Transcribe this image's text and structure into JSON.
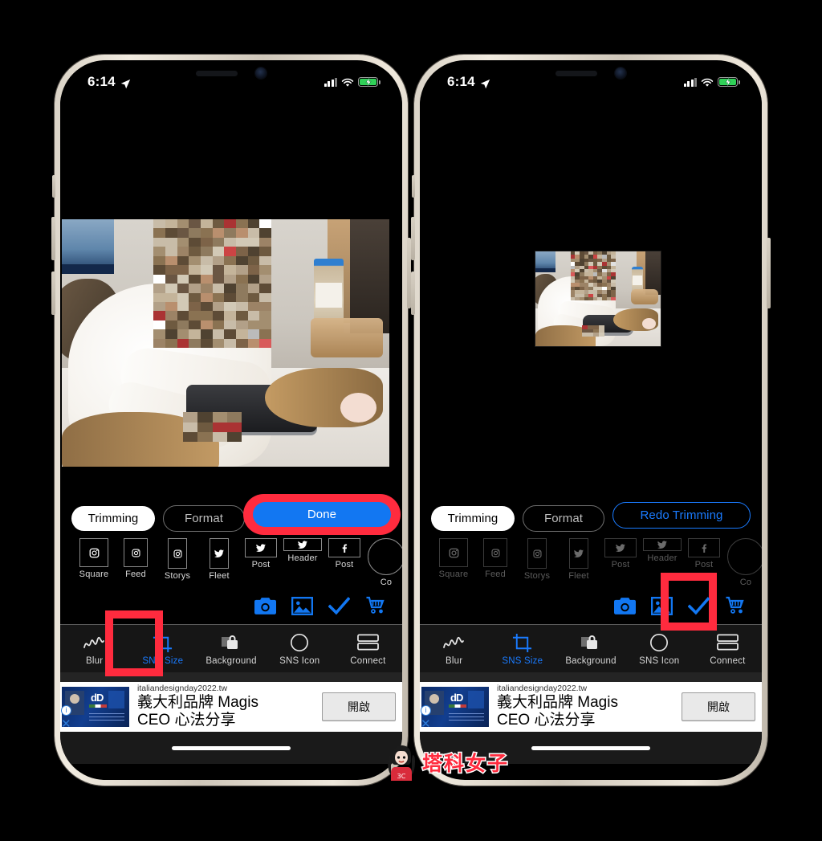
{
  "meta": {
    "accent_blue": "#1277f2",
    "highlight_red": "#ff2b3e",
    "link_blue": "#1a7bff",
    "battery_green": "#30d158"
  },
  "watermark": {
    "text": "塔科女子",
    "badge": "3C"
  },
  "phones": [
    {
      "id": "left",
      "status_bar": {
        "time": "6:14",
        "location_icon": "location-arrow-icon",
        "cellular_icon": "cellular-bars-icon",
        "wifi_icon": "wifi-icon",
        "battery_icon": "battery-charging-icon"
      },
      "editor": {
        "tabs": {
          "trimming": "Trimming",
          "format": "Format"
        },
        "primary_action": "Done",
        "primary_action_highlighted": true,
        "formats": [
          {
            "label": "Square",
            "icon": "instagram-icon",
            "shape": "sq"
          },
          {
            "label": "Feed",
            "icon": "instagram-icon",
            "shape": "fd"
          },
          {
            "label": "Storys",
            "icon": "instagram-icon",
            "shape": "st"
          },
          {
            "label": "Fleet",
            "icon": "twitter-icon",
            "shape": "fl"
          },
          {
            "label": "Post",
            "icon": "twitter-icon",
            "shape": "tw1"
          },
          {
            "label": "Header",
            "icon": "twitter-icon",
            "shape": "tw2"
          },
          {
            "label": "Post",
            "icon": "facebook-icon",
            "shape": "fb1"
          },
          {
            "label": "Co",
            "icon": "circle-icon",
            "shape": "cc"
          }
        ],
        "formats_dimmed": false,
        "action_icons": [
          {
            "name": "camera-icon"
          },
          {
            "name": "photo-library-icon"
          },
          {
            "name": "checkmark-icon"
          },
          {
            "name": "cart-icon"
          }
        ],
        "checkmark_highlighted": false
      },
      "tabbar": {
        "active": "SNS Size",
        "highlighted_tab": "SNS Size",
        "items": [
          {
            "label": "Blur",
            "icon": "scribble-icon"
          },
          {
            "label": "SNS Size",
            "icon": "crop-icon"
          },
          {
            "label": "Background",
            "icon": "lock-icon"
          },
          {
            "label": "SNS Icon",
            "icon": "circle-outline-icon"
          },
          {
            "label": "Connect",
            "icon": "stacked-rows-icon"
          }
        ]
      },
      "ad": {
        "url": "italiandesignday2022.tw",
        "headline_line1": "義大利品牌 Magis",
        "headline_line2": "CEO 心法分享",
        "cta": "開啟",
        "info_icon": "info-icon",
        "close_icon": "close-icon"
      },
      "photo": {
        "size": "large",
        "description": "cat lying on desk with mosaic-censored face"
      }
    },
    {
      "id": "right",
      "status_bar": {
        "time": "6:14",
        "location_icon": "location-arrow-icon",
        "cellular_icon": "cellular-bars-icon",
        "wifi_icon": "wifi-icon",
        "battery_icon": "battery-charging-icon"
      },
      "editor": {
        "tabs": {
          "trimming": "Trimming",
          "format": "Format"
        },
        "primary_action": "Redo Trimming",
        "primary_action_highlighted": false,
        "formats": [
          {
            "label": "Square",
            "icon": "instagram-icon",
            "shape": "sq"
          },
          {
            "label": "Feed",
            "icon": "instagram-icon",
            "shape": "fd"
          },
          {
            "label": "Storys",
            "icon": "instagram-icon",
            "shape": "st"
          },
          {
            "label": "Fleet",
            "icon": "twitter-icon",
            "shape": "fl"
          },
          {
            "label": "Post",
            "icon": "twitter-icon",
            "shape": "tw1"
          },
          {
            "label": "Header",
            "icon": "twitter-icon",
            "shape": "tw2"
          },
          {
            "label": "Post",
            "icon": "facebook-icon",
            "shape": "fb1"
          },
          {
            "label": "Co",
            "icon": "circle-icon",
            "shape": "cc"
          }
        ],
        "formats_dimmed": true,
        "action_icons": [
          {
            "name": "camera-icon"
          },
          {
            "name": "photo-library-icon"
          },
          {
            "name": "checkmark-icon"
          },
          {
            "name": "cart-icon"
          }
        ],
        "checkmark_highlighted": true
      },
      "tabbar": {
        "active": "SNS Size",
        "highlighted_tab": null,
        "items": [
          {
            "label": "Blur",
            "icon": "scribble-icon"
          },
          {
            "label": "SNS Size",
            "icon": "crop-icon"
          },
          {
            "label": "Background",
            "icon": "lock-icon"
          },
          {
            "label": "SNS Icon",
            "icon": "circle-outline-icon"
          },
          {
            "label": "Connect",
            "icon": "stacked-rows-icon"
          }
        ]
      },
      "ad": {
        "url": "italiandesignday2022.tw",
        "headline_line1": "義大利品牌 Magis",
        "headline_line2": "CEO 心法分享",
        "cta": "開啟",
        "info_icon": "info-icon",
        "close_icon": "close-icon"
      },
      "photo": {
        "size": "small",
        "description": "cat lying on desk with mosaic-censored face, shrunk to SNS size"
      }
    }
  ]
}
